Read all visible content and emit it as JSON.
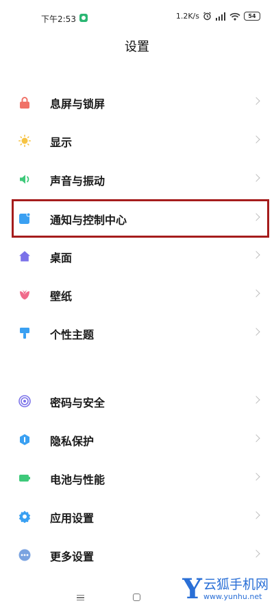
{
  "status_bar": {
    "time": "下午2:53",
    "net_speed": "1.2K/s",
    "battery": "54"
  },
  "header": {
    "title": "设置"
  },
  "settings": {
    "group1": [
      {
        "label": "息屏与锁屏",
        "icon": "lock-icon",
        "color": "#f07167"
      },
      {
        "label": "显示",
        "icon": "sun-icon",
        "color": "#f6c343"
      },
      {
        "label": "声音与振动",
        "icon": "speaker-icon",
        "color": "#3ec97a"
      },
      {
        "label": "通知与控制中心",
        "icon": "notification-icon",
        "color": "#3aa0f2"
      },
      {
        "label": "桌面",
        "icon": "home-icon",
        "color": "#7b72e9"
      },
      {
        "label": "壁纸",
        "icon": "tulip-icon",
        "color": "#f06a8a"
      },
      {
        "label": "个性主题",
        "icon": "brush-icon",
        "color": "#3aa0f2"
      }
    ],
    "group2": [
      {
        "label": "密码与安全",
        "icon": "fingerprint-icon",
        "color": "#7b72e9"
      },
      {
        "label": "隐私保护",
        "icon": "privacy-shield-icon",
        "color": "#3aa0f2"
      },
      {
        "label": "电池与性能",
        "icon": "battery-icon",
        "color": "#3ec97a"
      },
      {
        "label": "应用设置",
        "icon": "gear-icon",
        "color": "#3aa0f2"
      },
      {
        "label": "更多设置",
        "icon": "more-icon",
        "color": "#7aa3e0"
      }
    ]
  },
  "watermark": {
    "letter": "Y",
    "brand": "云狐手机网",
    "url": "www.yunhu.net"
  }
}
